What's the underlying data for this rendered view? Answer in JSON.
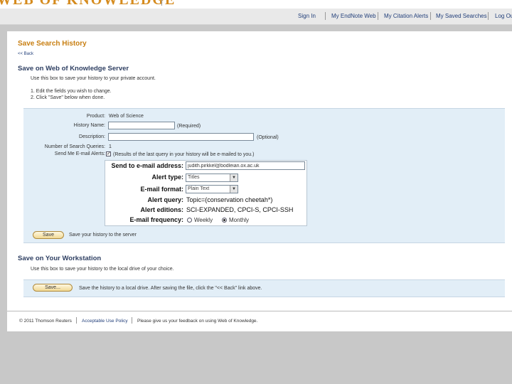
{
  "brand": {
    "logo_text": "WEB OF KNOWLEDGE"
  },
  "header_links": [
    "Sign In",
    "My EndNote Web",
    "My Citation Alerts",
    "My Saved Searches",
    "Log Out"
  ],
  "page": {
    "title": "Save Search History",
    "back_link": "<< Back"
  },
  "server_section": {
    "heading": "Save on Web of Knowledge Server",
    "intro": "Use this box to save your history to your private account.",
    "step1": "1. Edit the fields you wish to change.",
    "step2": "2. Click \"Save\" below when done.",
    "form": {
      "product_label": "Product:",
      "product_value": "Web of Science",
      "history_name_label": "History Name:",
      "history_name_value": "",
      "history_name_note": "(Required)",
      "description_label": "Description:",
      "description_value": "",
      "description_note": "(Optional)",
      "num_queries_label": "Number of Search Queries:",
      "num_queries_value": "1",
      "email_alerts_label": "Send Me E-mail Alerts:",
      "email_alerts_checked": "✓",
      "email_alerts_note": "(Results of the last query in your history will be e-mailed to you.)"
    },
    "alert": {
      "send_to_label": "Send to e-mail address:",
      "send_to_value": "judith.pirkkel@bodleian.ox.ac.uk",
      "type_label": "Alert type:",
      "type_value": "Titles",
      "format_label": "E-mail format:",
      "format_value": "Plain Text",
      "query_label": "Alert query:",
      "query_value": "Topic=(conservation cheetah*)",
      "editions_label": "Alert editions:",
      "editions_value": "SCI-EXPANDED, CPCI-S, CPCI-SSH",
      "frequency_label": "E-mail frequency:",
      "frequency_weekly": "Weekly",
      "frequency_monthly": "Monthly",
      "frequency_selected": "Monthly"
    },
    "save_button": "Save",
    "save_note": "Save your history to the server"
  },
  "workstation_section": {
    "heading": "Save on Your Workstation",
    "intro": "Use this box to save your history to the local drive of your choice.",
    "save_button": "Save...",
    "save_note": "Save the history to a local drive. After saving the file, click the \"<< Back\" link above."
  },
  "footer": {
    "copyright": "© 2011 Thomson Reuters",
    "policy_link": "Acceptable Use Policy",
    "feedback": "Please give us your feedback on using Web of Knowledge."
  },
  "colors": {
    "accent_orange": "#c87f12",
    "heading_blue": "#2e3f62",
    "band_blue": "#e2eef7",
    "link_blue": "#223f7a"
  }
}
